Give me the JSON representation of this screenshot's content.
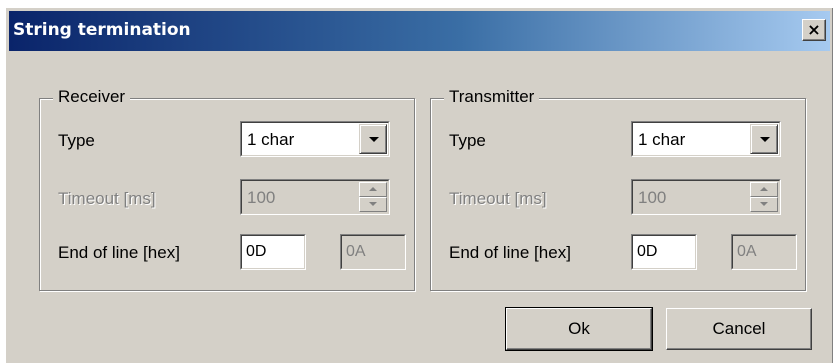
{
  "window": {
    "title": "String termination",
    "close_glyph": "✕"
  },
  "receiver": {
    "legend": "Receiver",
    "type_label": "Type",
    "type_value": "1 char",
    "timeout_label": "Timeout [ms]",
    "timeout_value": "100",
    "eol_label": "End of line [hex]",
    "eol_value1": "0D",
    "eol_value2": "0A"
  },
  "transmitter": {
    "legend": "Transmitter",
    "type_label": "Type",
    "type_value": "1 char",
    "timeout_label": "Timeout [ms]",
    "timeout_value": "100",
    "eol_label": "End of line [hex]",
    "eol_value1": "0D",
    "eol_value2": "0A"
  },
  "buttons": {
    "ok_label": "Ok",
    "cancel_label": "Cancel"
  },
  "colors": {
    "face": "#d4d0c8",
    "title_start": "#0a246a",
    "title_end": "#a6caf0",
    "disabled_text": "#808080"
  }
}
